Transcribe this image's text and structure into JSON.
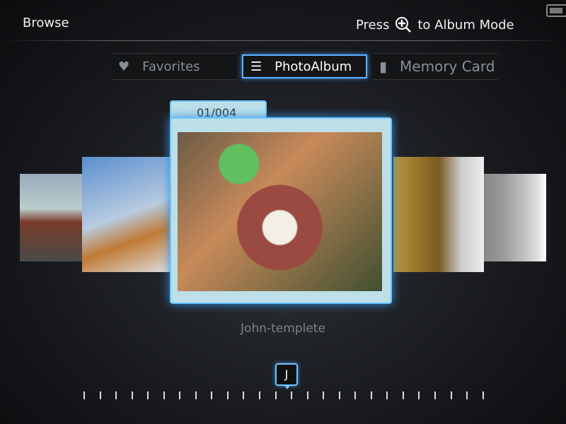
{
  "header": {
    "title": "Browse",
    "hint_prefix": "Press",
    "hint_icon": "zoom-in-icon",
    "hint_suffix": "to Album Mode",
    "battery_icon": "battery-icon"
  },
  "tabs": [
    {
      "label": "Favorites",
      "icon": "heart-icon",
      "selected": false
    },
    {
      "label": "PhotoAlbum",
      "icon": "list-icon",
      "selected": true
    },
    {
      "label": "Memory Card",
      "icon": "card-icon",
      "selected": false
    }
  ],
  "album": {
    "counter": "01/004",
    "caption": "John-templete"
  },
  "index": {
    "letter": "J",
    "tick_count": 26,
    "position": 13
  },
  "accent": "#5fb0ff"
}
